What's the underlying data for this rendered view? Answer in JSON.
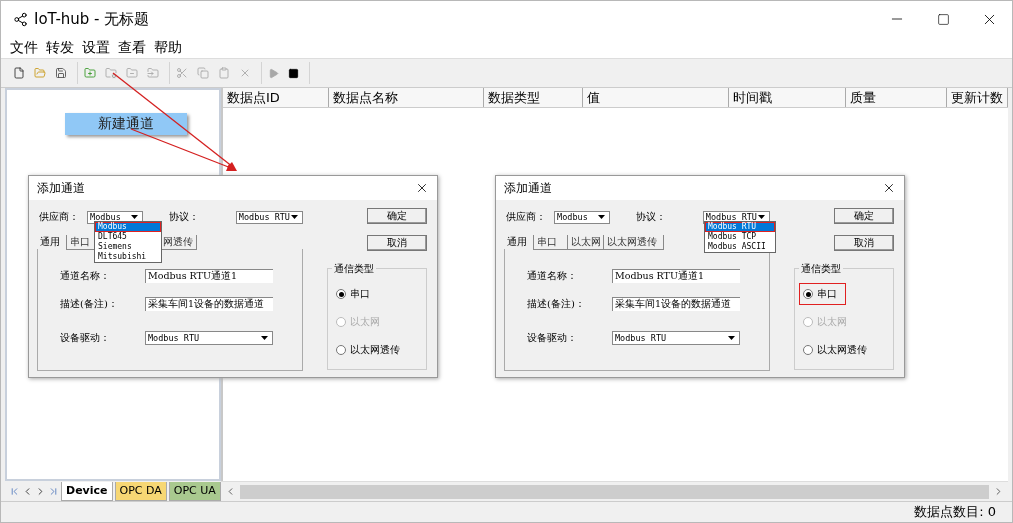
{
  "window": {
    "title": "IoT-hub - 无标题"
  },
  "menu": [
    "文件",
    "转发",
    "设置",
    "查看",
    "帮助"
  ],
  "toolbar": {
    "groups": [
      [
        {
          "kind": "new",
          "disabled": false
        },
        {
          "kind": "open",
          "disabled": false
        },
        {
          "kind": "save",
          "disabled": false
        }
      ],
      [
        {
          "kind": "add_channel",
          "disabled": false
        },
        {
          "kind": "edit",
          "disabled": true
        },
        {
          "kind": "remove",
          "disabled": true
        },
        {
          "kind": "properties",
          "disabled": true
        }
      ],
      [
        {
          "kind": "cut",
          "disabled": true
        },
        {
          "kind": "copy",
          "disabled": true
        },
        {
          "kind": "paste",
          "disabled": true
        },
        {
          "kind": "delete",
          "disabled": true
        }
      ],
      [
        {
          "kind": "start",
          "disabled": true
        },
        {
          "kind": "stop",
          "disabled": false
        }
      ]
    ]
  },
  "context_menu": {
    "items": [
      {
        "label": "新建通道",
        "selected": true
      }
    ]
  },
  "table": {
    "columns": [
      "数据点ID",
      "数据点名称",
      "数据类型",
      "值",
      "时间戳",
      "质量",
      "更新计数"
    ]
  },
  "sheet_tabs": [
    {
      "label": "Device",
      "selected": true,
      "color": "#ffffff"
    },
    {
      "label": "OPC DA",
      "selected": false,
      "color": "#f7d774"
    },
    {
      "label": "OPC UA",
      "selected": false,
      "color": "#a9c98f"
    }
  ],
  "status_bar": {
    "text": "数据点数目: 0"
  },
  "dialogs": [
    {
      "title": "添加通道",
      "supplier": {
        "label": "供应商：",
        "value": "Modbus",
        "options": [
          {
            "label": "Modbus",
            "selected": true,
            "annotated": true
          },
          {
            "label": "DLT645",
            "selected": false,
            "annotated": false
          },
          {
            "label": "Siemens",
            "selected": false,
            "annotated": false
          },
          {
            "label": "Mitsubishi",
            "selected": false,
            "annotated": false
          }
        ]
      },
      "protocol": {
        "label": "协议：",
        "value": "Modbus RTU"
      },
      "tabs": [
        {
          "label": "通用",
          "selected": true
        },
        {
          "label": "串口",
          "selected": false
        },
        {
          "label": "网透传",
          "selected": false
        }
      ],
      "fields": [
        {
          "kind": "text",
          "label": "通道名称：",
          "value": "Modbus RTU通道1"
        },
        {
          "kind": "text",
          "label": "描述(备注)：",
          "value": "采集车间1设备的数据通道"
        },
        {
          "kind": "select",
          "label": "设备驱动：",
          "value": "Modbus RTU"
        }
      ],
      "buttons": [
        "确定",
        "取消"
      ],
      "group": {
        "title": "通信类型",
        "radios": [
          {
            "label": "串口",
            "selected": true,
            "disabled": false,
            "annotated": false
          },
          {
            "label": "以太网",
            "selected": false,
            "disabled": true,
            "annotated": false
          },
          {
            "label": "以太网透传",
            "selected": false,
            "disabled": false,
            "annotated": false
          }
        ]
      }
    },
    {
      "title": "添加通道",
      "supplier": {
        "label": "供应商：",
        "value": "Modbus"
      },
      "protocol": {
        "label": "协议：",
        "value": "Modbus RTU",
        "options": [
          {
            "label": "Modbus RTU",
            "selected": true,
            "annotated": true
          },
          {
            "label": "Modbus TCP",
            "selected": false,
            "annotated": false
          },
          {
            "label": "Modbus ASCII",
            "selected": false,
            "annotated": false
          }
        ]
      },
      "tabs": [
        {
          "label": "通用",
          "selected": true
        },
        {
          "label": "串口",
          "selected": false
        },
        {
          "label": "以太网",
          "selected": false
        },
        {
          "label": "以太网透传",
          "selected": false
        }
      ],
      "fields": [
        {
          "kind": "text",
          "label": "通道名称：",
          "value": "Modbus RTU通道1"
        },
        {
          "kind": "text",
          "label": "描述(备注)：",
          "value": "采集车间1设备的数据通道"
        },
        {
          "kind": "select",
          "label": "设备驱动：",
          "value": "Modbus RTU"
        }
      ],
      "buttons": [
        "确定",
        "取消"
      ],
      "group": {
        "title": "通信类型",
        "radios": [
          {
            "label": "串口",
            "selected": true,
            "disabled": false,
            "annotated": true
          },
          {
            "label": "以太网",
            "selected": false,
            "disabled": true,
            "annotated": false
          },
          {
            "label": "以太网透传",
            "selected": false,
            "disabled": false,
            "annotated": false
          }
        ]
      }
    }
  ]
}
